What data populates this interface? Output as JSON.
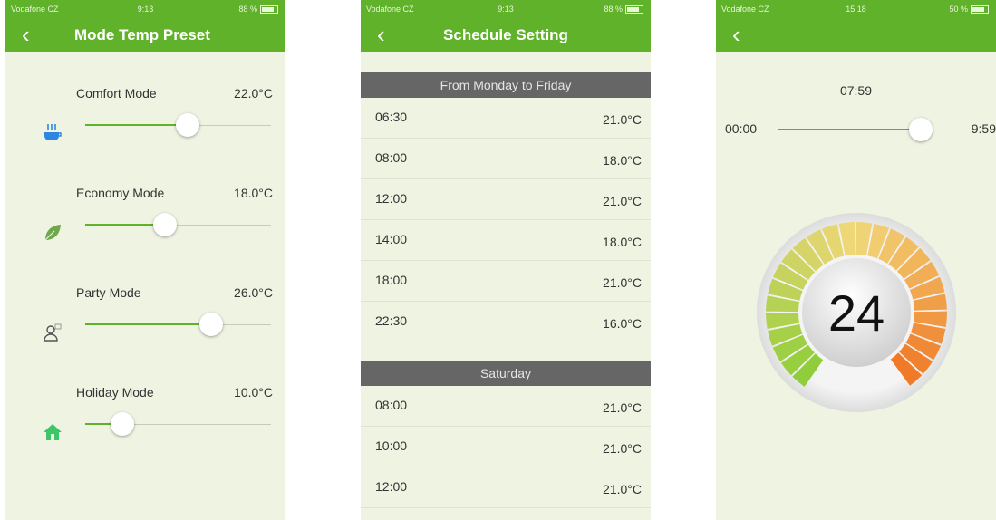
{
  "status": {
    "carrier": "Vodafone CZ",
    "time_1": "9:13",
    "time_2": "9:13",
    "time_3": "15:18",
    "battery_1": "88 %",
    "battery_2": "88 %",
    "battery_3": "50 %"
  },
  "screen1": {
    "title": "Mode Temp Preset",
    "back": "‹",
    "modes": [
      {
        "name": "Comfort Mode",
        "value": "22.0°C",
        "icon": "coffee-cup-icon",
        "fraction": 0.55
      },
      {
        "name": "Economy Mode",
        "value": "18.0°C",
        "icon": "leaf-icon",
        "fraction": 0.43
      },
      {
        "name": "Party Mode",
        "value": "26.0°C",
        "icon": "person-icon",
        "fraction": 0.68
      },
      {
        "name": "Holiday Mode",
        "value": "10.0°C",
        "icon": "house-icon",
        "fraction": 0.2
      }
    ]
  },
  "screen2": {
    "title": "Schedule Setting",
    "back": "‹",
    "sections": [
      {
        "header": "From Monday to Friday",
        "rows": [
          {
            "time": "06:30",
            "value": "21.0°C"
          },
          {
            "time": "08:00",
            "value": "18.0°C"
          },
          {
            "time": "12:00",
            "value": "21.0°C"
          },
          {
            "time": "14:00",
            "value": "18.0°C"
          },
          {
            "time": "18:00",
            "value": "21.0°C"
          },
          {
            "time": "22:30",
            "value": "16.0°C"
          }
        ]
      },
      {
        "header": "Saturday",
        "rows": [
          {
            "time": "08:00",
            "value": "21.0°C"
          },
          {
            "time": "10:00",
            "value": "21.0°C"
          },
          {
            "time": "12:00",
            "value": "21.0°C"
          }
        ]
      }
    ]
  },
  "screen3": {
    "back": "‹",
    "time": "07:59",
    "range_start": "00:00",
    "range_end": "9:59",
    "time_fraction": 0.8,
    "temperature": "24",
    "temperature_fraction": 0.5,
    "colors": {
      "accent": "#5fb22a",
      "low": "#8fce3a",
      "mid": "#f1d77a",
      "high": "#f07a28"
    }
  }
}
